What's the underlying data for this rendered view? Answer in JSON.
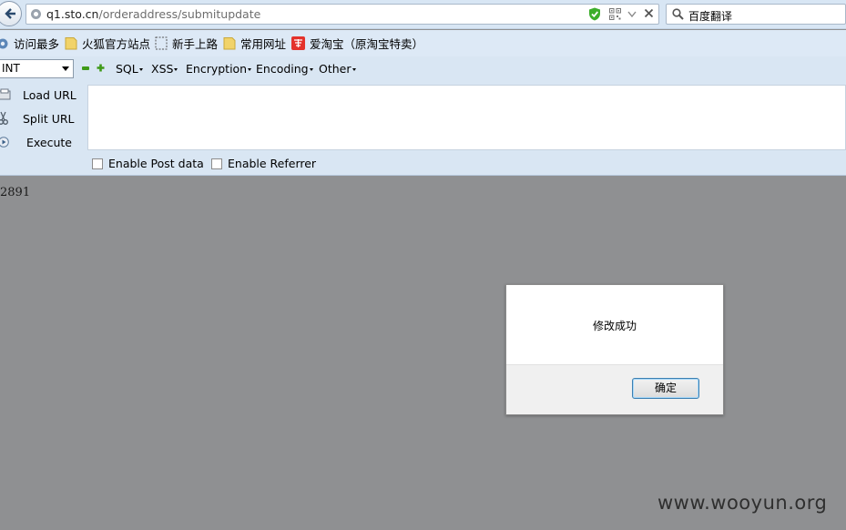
{
  "browser": {
    "url_host": "q1.sto.cn",
    "url_path": "/orderaddress/submitupdate",
    "search_text": "百度翻译"
  },
  "bookmarks": [
    {
      "label": "访问最多",
      "icon": "gear-icon"
    },
    {
      "label": "火狐官方站点",
      "icon": "folder-icon"
    },
    {
      "label": "新手上路",
      "icon": "dotted-page-icon"
    },
    {
      "label": "常用网址",
      "icon": "folder-icon"
    },
    {
      "label": "爱淘宝（原淘宝特卖）",
      "icon": "taobao-icon"
    }
  ],
  "hackbar": {
    "type_select": "INT",
    "menus": [
      "SQL",
      "XSS",
      "Encryption",
      "Encoding",
      "Other"
    ],
    "load_url": "Load URL",
    "split_url": "Split URL",
    "execute": "Execute",
    "enable_post": "Enable Post data",
    "enable_referrer": "Enable Referrer"
  },
  "content": {
    "result": "2891"
  },
  "dialog": {
    "message": "修改成功",
    "ok_label": "确定"
  },
  "watermark": "www.wooyun.org",
  "colors": {
    "toolbar_bg": "#d9e6f3",
    "content_bg": "#8f9092",
    "shield_green": "#3dae2b"
  }
}
